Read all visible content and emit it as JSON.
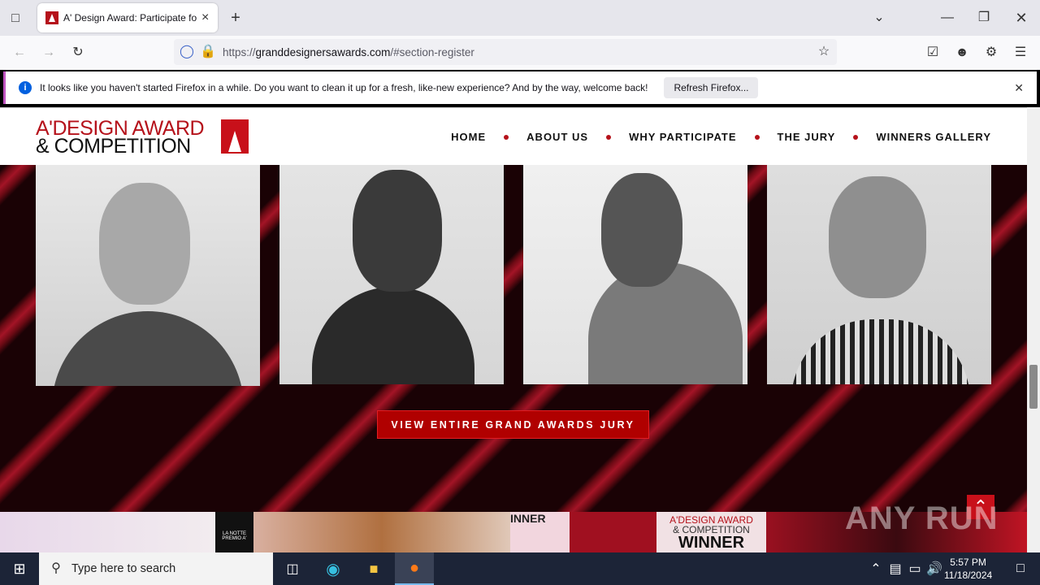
{
  "browser": {
    "tab_title": "A' Design Award: Participate for",
    "url_host": "granddesignersawards.com",
    "url_prefix": "https://",
    "url_path": "/#section-register",
    "notice_text": "It looks like you haven't started Firefox in a while. Do you want to clean it up for a fresh, like-new experience? And by the way, welcome back!",
    "notice_button": "Refresh Firefox..."
  },
  "site": {
    "logo_line1": "A'DESIGN AWARD",
    "logo_line2": "& COMPETITION",
    "menu": [
      "HOME",
      "ABOUT US",
      "WHY PARTICIPATE",
      "THE JURY",
      "WINNERS GALLERY"
    ],
    "cta": "VIEW ENTIRE GRAND AWARDS JURY",
    "strip_text1": "LA NOTTE PREMIO A'",
    "strip_text2": "INNER",
    "strip_text3": "A'DESIGN AWARD",
    "strip_text4": "& COMPETITION",
    "strip_text5": "WINNER"
  },
  "watermark": "ANY RUN",
  "taskbar": {
    "search_placeholder": "Type here to search",
    "time": "5:57 PM",
    "date": "11/18/2024"
  },
  "colors": {
    "brand_red": "#b5121b",
    "cta_red": "#b00000"
  }
}
